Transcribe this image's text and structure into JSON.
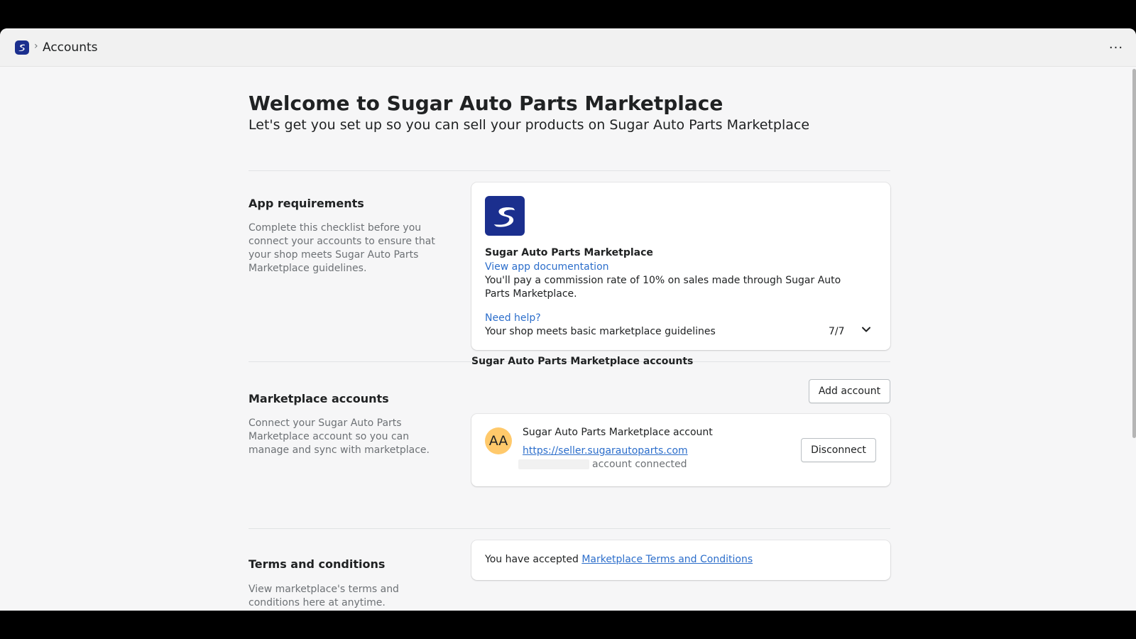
{
  "topbar": {
    "breadcrumb_title": "Accounts",
    "breadcrumb_separator": "›",
    "more_label": "···"
  },
  "header": {
    "title": "Welcome to Sugar Auto Parts Marketplace",
    "subtitle": "Let's get you set up so you can sell your products on Sugar Auto Parts Marketplace"
  },
  "requirements": {
    "title": "App requirements",
    "description": "Complete this checklist before you connect your accounts to ensure that your shop meets Sugar Auto Parts Marketplace guidelines.",
    "card": {
      "app_name": "Sugar Auto Parts Marketplace",
      "doc_link": "View app documentation",
      "commission_text": "You'll pay a commission rate of 10% on sales made through Sugar Auto Parts Marketplace.",
      "help_link": "Need help?",
      "checklist_text": "Your shop meets basic marketplace guidelines",
      "checklist_progress": "7/7"
    }
  },
  "marketplace_accounts": {
    "title": "Marketplace accounts",
    "description": "Connect your Sugar Auto Parts Marketplace account so you can manage and sync with marketplace.",
    "list_header": "Sugar Auto Parts Marketplace accounts",
    "add_button": "Add account",
    "account": {
      "initials": "AA",
      "name": "Sugar Auto Parts Marketplace account",
      "url": "https://seller.sugarautoparts.com",
      "status": "account connected",
      "disconnect_button": "Disconnect"
    }
  },
  "terms": {
    "title": "Terms and conditions",
    "description": "View marketplace's terms and conditions here at anytime.",
    "accepted_prefix": "You have accepted",
    "terms_link": "Marketplace Terms and Conditions"
  },
  "colors": {
    "brand": "#1b2f8e",
    "link": "#2c6ecb",
    "avatar": "#ffc96b"
  }
}
